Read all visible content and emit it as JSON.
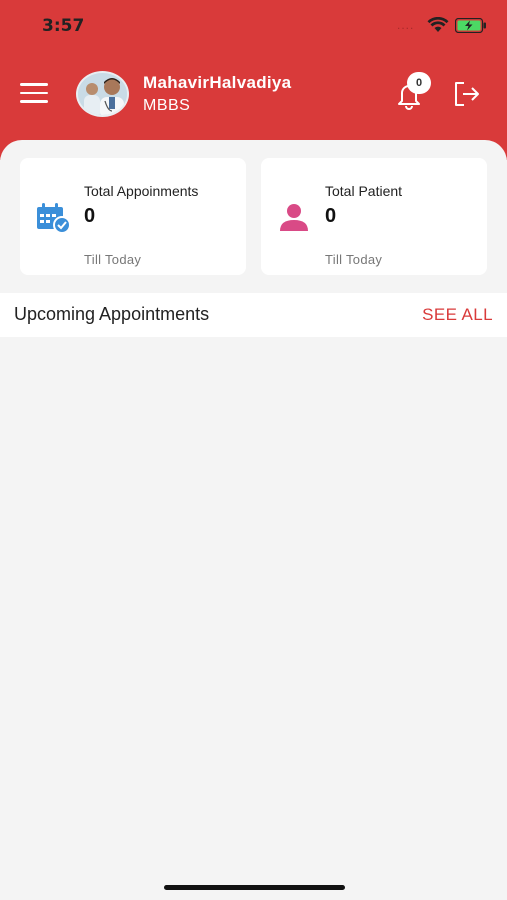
{
  "status_bar": {
    "time": "3:57",
    "signal": "....",
    "icons": [
      "wifi-icon",
      "battery-charging-icon"
    ]
  },
  "header": {
    "doctor_name": "MahavirHalvadiya",
    "doctor_degree": "MBBS",
    "notification_count": "0",
    "icons": [
      "menu-icon",
      "bell-icon",
      "logout-icon"
    ],
    "accent_color": "#d93a3a"
  },
  "stats": [
    {
      "title": "Total Appoinments",
      "value": "0",
      "subtitle": "Till Today",
      "icon": "calendar-check-icon",
      "icon_color": "#3b8fd9"
    },
    {
      "title": "Total Patient",
      "value": "0",
      "subtitle": "Till Today",
      "icon": "person-icon",
      "icon_color": "#d94a86"
    }
  ],
  "upcoming": {
    "title": "Upcoming Appointments",
    "see_all_label": "SEE ALL"
  }
}
